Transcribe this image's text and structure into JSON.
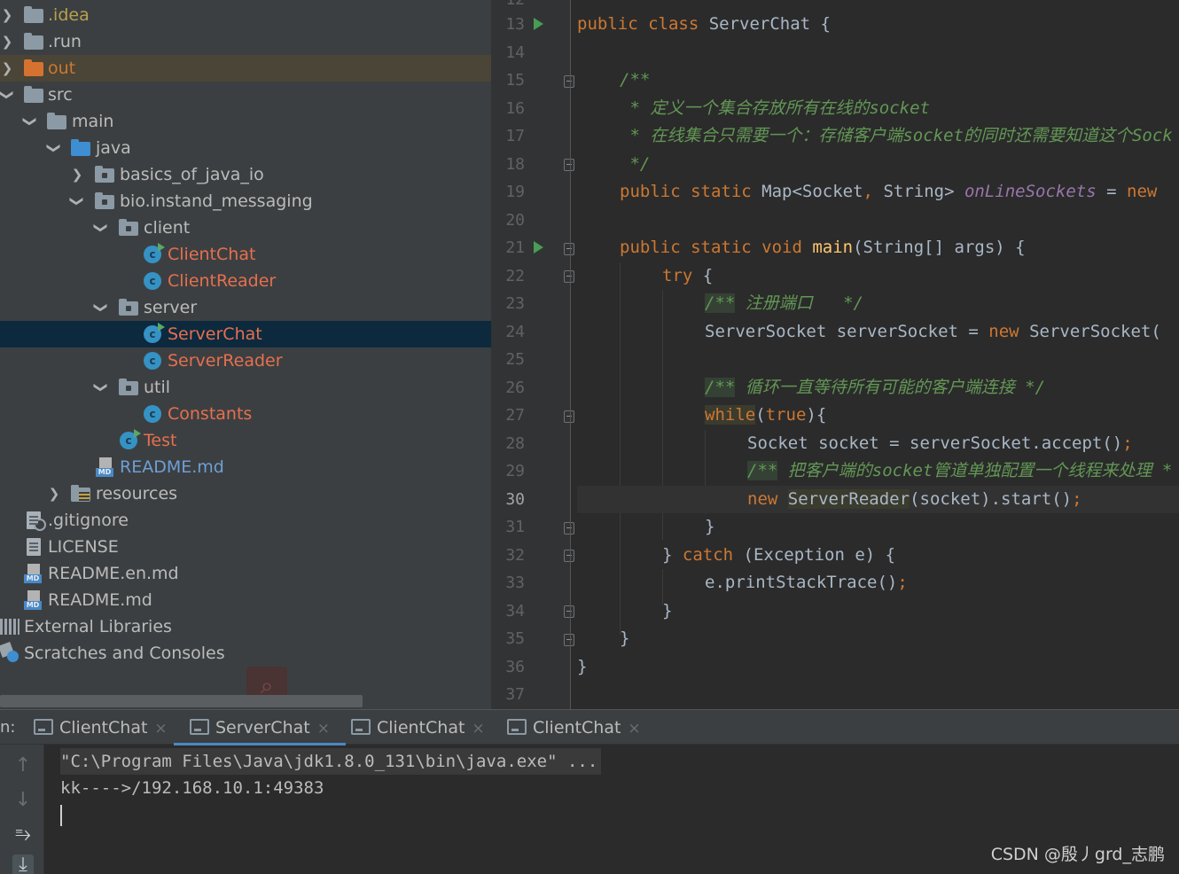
{
  "project_tree": {
    "items": [
      {
        "label": ".idea"
      },
      {
        "label": ".run"
      },
      {
        "label": "out"
      },
      {
        "label": "src"
      },
      {
        "label": "main"
      },
      {
        "label": "java"
      },
      {
        "label": "basics_of_java_io"
      },
      {
        "label": "bio.instand_messaging"
      },
      {
        "label": "client"
      },
      {
        "label": "ClientChat"
      },
      {
        "label": "ClientReader"
      },
      {
        "label": "server"
      },
      {
        "label": "ServerChat"
      },
      {
        "label": "ServerReader"
      },
      {
        "label": "util"
      },
      {
        "label": "Constants"
      },
      {
        "label": "Test"
      },
      {
        "label": "README.md"
      },
      {
        "label": "resources"
      },
      {
        "label": ".gitignore"
      },
      {
        "label": "LICENSE"
      },
      {
        "label": "README.en.md"
      },
      {
        "label": "README.md"
      },
      {
        "label": "External Libraries"
      },
      {
        "label": "Scratches and Consoles"
      }
    ],
    "md_tag": "MD"
  },
  "editor": {
    "line_numbers": [
      "12",
      "13",
      "14",
      "15",
      "16",
      "17",
      "18",
      "19",
      "20",
      "21",
      "22",
      "23",
      "24",
      "25",
      "26",
      "27",
      "28",
      "29",
      "30",
      "31",
      "32",
      "33",
      "34",
      "35",
      "36",
      "37"
    ],
    "current_line": "30",
    "lines": {
      "l13": {
        "kw1": "public class ",
        "name": "ServerChat {"
      },
      "l15": {
        "doc": "/**"
      },
      "l16": {
        "doc": " * 定义一个集合存放所有在线的socket"
      },
      "l17": {
        "doc": " * 在线集合只需要一个：存储客户端socket的同时还需要知道这个Sock"
      },
      "l18": {
        "doc": " */"
      },
      "l19": {
        "kw": "public static ",
        "type": "Map<Socket",
        "comma": ", ",
        "type2": "String> ",
        "field": "onLineSockets",
        "eq": " = ",
        "kw2": "new"
      },
      "l21": {
        "kw": "public static void ",
        "method": "main",
        "rest": "(String[] args) {"
      },
      "l22": {
        "kw": "try",
        "rest": " {"
      },
      "l23": {
        "doc_hl": "/**",
        "doc": " 注册端口   */"
      },
      "l24": {
        "plain": "ServerSocket serverSocket = ",
        "kw": "new",
        "plain2": " ServerSocket("
      },
      "l26": {
        "doc_hl": "/**",
        "doc": " 循环一直等待所有可能的客户端连接 */"
      },
      "l27": {
        "kw": "while",
        "p1": "(",
        "kw2": "true",
        "p2": "){"
      },
      "l28": {
        "plain": "Socket socket = serverSocket.accept()",
        "semi": ";"
      },
      "l29": {
        "doc_hl": "/**",
        "doc": " 把客户端的socket管道单独配置一个线程来处理 *"
      },
      "l30": {
        "kw": "new",
        "sp": " ",
        "cls": "ServerReader",
        "plain": "(socket).start()",
        "semi": ";"
      },
      "l31": {
        "plain": "}"
      },
      "l32": {
        "plain": "} ",
        "kw": "catch",
        "plain2": " (Exception e) {"
      },
      "l33": {
        "plain": "e.printStackTrace()",
        "semi": ";"
      },
      "l34": {
        "plain": "}"
      },
      "l35": {
        "plain": "}"
      },
      "l36": {
        "plain": "}"
      }
    }
  },
  "run_panel": {
    "label": "n:",
    "tabs": [
      {
        "label": "ClientChat",
        "close": "×"
      },
      {
        "label": "ServerChat",
        "close": "×"
      },
      {
        "label": "ClientChat",
        "close": "×"
      },
      {
        "label": "ClientChat",
        "close": "×"
      }
    ],
    "active_tab": "ServerChat",
    "tools": {
      "up": "↑",
      "down": "↓",
      "wrap": "⥱",
      "scroll": "⤓"
    },
    "console": {
      "command": "\"C:\\Program Files\\Java\\jdk1.8.0_131\\bin\\java.exe\" ...",
      "output": "kk---->/192.168.10.1:49383"
    }
  },
  "search_icon_glyph": "⌕",
  "watermark": "CSDN @殷丿grd_志鹏"
}
